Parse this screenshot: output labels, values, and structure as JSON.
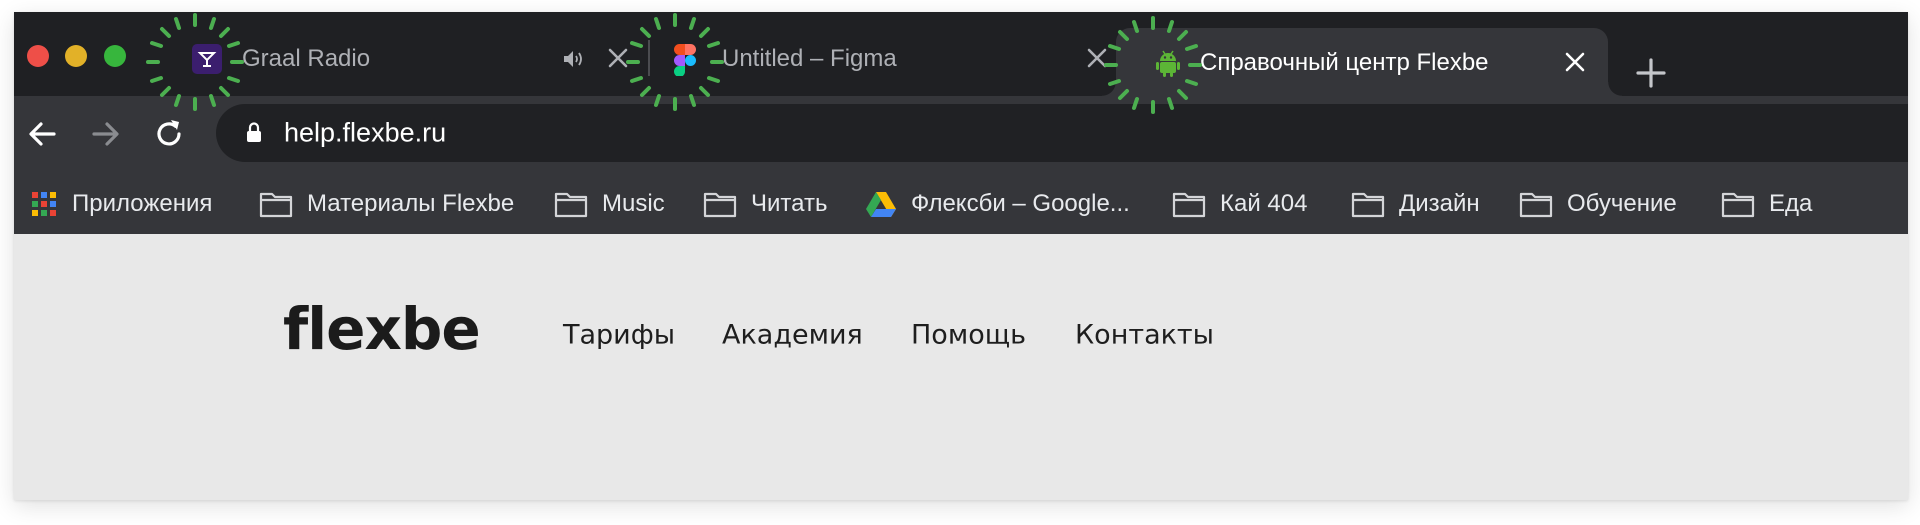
{
  "tabs": [
    {
      "title": "Graal Radio",
      "favicon": "cocktail-glass-icon",
      "muted_indicator": "speaker-icon",
      "active": false
    },
    {
      "title": "Untitled – Figma",
      "favicon": "figma-icon",
      "active": false
    },
    {
      "title": "Справочный центр Flexbe",
      "favicon": "android-robot-icon",
      "active": true
    }
  ],
  "toolbar": {
    "back": "arrow-left-icon",
    "forward": "arrow-right-icon",
    "reload": "reload-icon",
    "url": "help.flexbe.ru"
  },
  "bookmarks": [
    {
      "label": "Приложения",
      "icon": "apps-grid-icon"
    },
    {
      "label": "Материалы Flexbe",
      "icon": "folder-icon"
    },
    {
      "label": "Music",
      "icon": "folder-icon"
    },
    {
      "label": "Читать",
      "icon": "folder-icon"
    },
    {
      "label": "Флексби – Google...",
      "icon": "google-drive-icon"
    },
    {
      "label": "Кай 404",
      "icon": "folder-icon"
    },
    {
      "label": "Дизайн",
      "icon": "folder-icon"
    },
    {
      "label": "Обучение",
      "icon": "folder-icon"
    },
    {
      "label": "Еда",
      "icon": "folder-icon"
    }
  ],
  "site": {
    "logo": "flexbe",
    "nav": [
      "Тарифы",
      "Академия",
      "Помощь",
      "Контакты"
    ]
  },
  "colors": {
    "chrome_bg": "#1f2023",
    "toolbar_bg": "#35363a",
    "page_bg": "#e8e8e8",
    "highlight_burst": "#4caf50"
  }
}
